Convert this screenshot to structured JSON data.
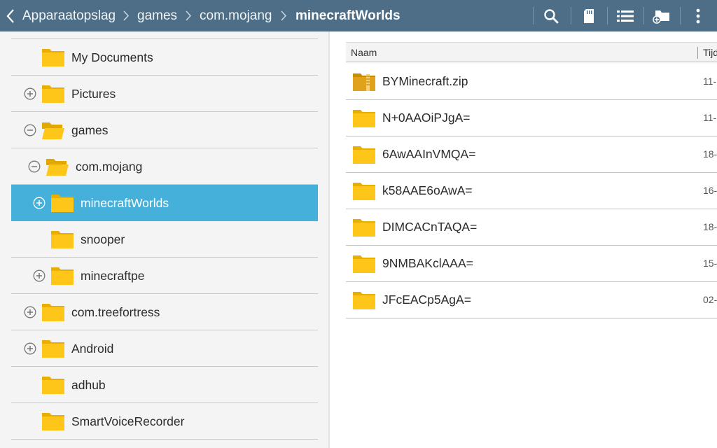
{
  "colors": {
    "action_bar": "#4d6e86",
    "selected_row": "#45b0da",
    "folder": "#ffc61a"
  },
  "breadcrumb": [
    {
      "label": "Apparaatopslag"
    },
    {
      "label": "games"
    },
    {
      "label": "com.mojang"
    },
    {
      "label": "minecraftWorlds"
    }
  ],
  "toolbar": {
    "icons": [
      "search-icon",
      "sd-card-icon",
      "list-view-icon",
      "add-folder-icon",
      "overflow-menu-icon"
    ]
  },
  "tree": {
    "items": [
      {
        "label": "My Documents",
        "expander": "none",
        "level": 0,
        "open": false
      },
      {
        "label": "Pictures",
        "expander": "plus",
        "level": 0,
        "open": false
      },
      {
        "label": "games",
        "expander": "minus",
        "level": 0,
        "open": true
      },
      {
        "label": "com.mojang",
        "expander": "minus",
        "level": 1,
        "open": true
      },
      {
        "label": "minecraftWorlds",
        "expander": "plus",
        "level": 2,
        "open": false,
        "selected": true
      },
      {
        "label": "snooper",
        "expander": "none",
        "level": 2,
        "open": false
      },
      {
        "label": "minecraftpe",
        "expander": "plus",
        "level": 2,
        "open": false
      },
      {
        "label": "com.treefortress",
        "expander": "plus",
        "level": 0,
        "open": false
      },
      {
        "label": "Android",
        "expander": "plus",
        "level": 0,
        "open": false
      },
      {
        "label": "adhub",
        "expander": "none",
        "level": 0,
        "open": false
      },
      {
        "label": "SmartVoiceRecorder",
        "expander": "none",
        "level": 0,
        "open": false
      }
    ]
  },
  "filelist": {
    "columns": {
      "name": "Naam",
      "time": "Tijd"
    },
    "files": [
      {
        "name": "BYMinecraft.zip",
        "date": "11-",
        "type": "zip"
      },
      {
        "name": "N+0AAOiPJgA=",
        "date": "11-",
        "type": "folder"
      },
      {
        "name": "6AwAAInVMQA=",
        "date": "18-",
        "type": "folder"
      },
      {
        "name": "k58AAE6oAwA=",
        "date": "16-",
        "type": "folder"
      },
      {
        "name": "DIMCACnTAQA=",
        "date": "18-",
        "type": "folder"
      },
      {
        "name": "9NMBAKclAAA=",
        "date": "15-",
        "type": "folder"
      },
      {
        "name": "JFcEACp5AgA=",
        "date": "02-",
        "type": "folder"
      }
    ]
  }
}
